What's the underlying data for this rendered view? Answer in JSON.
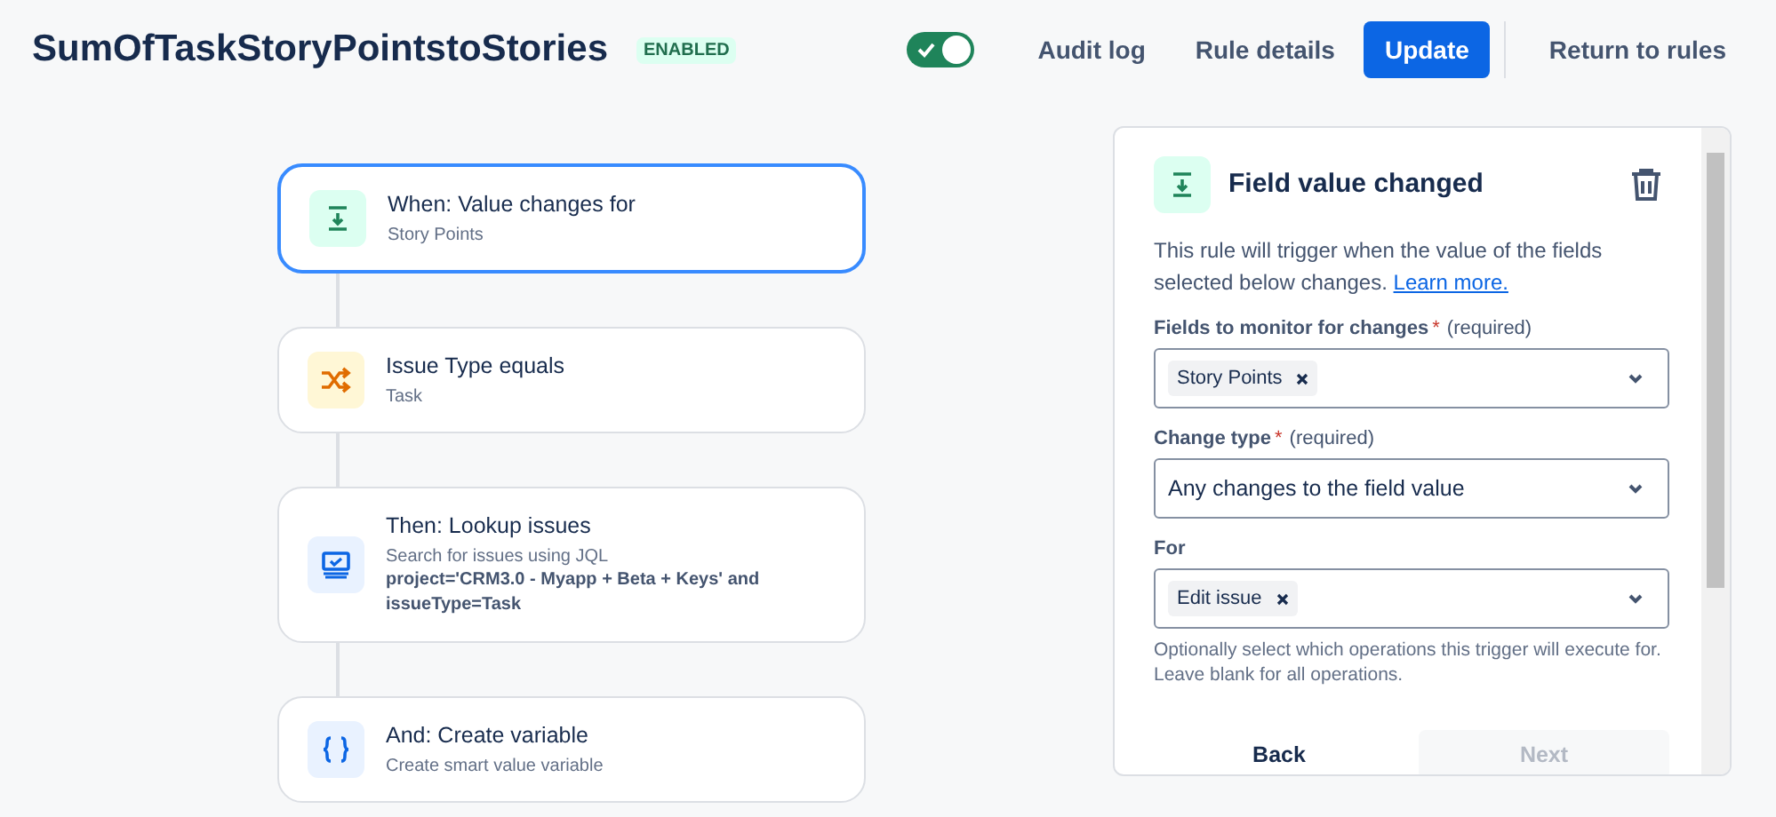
{
  "header": {
    "title": "SumOfTaskStoryPointstoStories",
    "status_badge": "ENABLED",
    "toggle_on": true,
    "actions": [
      {
        "label": "Audit log",
        "kind": "subtle"
      },
      {
        "label": "Rule details",
        "kind": "subtle"
      },
      {
        "label": "Update",
        "kind": "primary"
      },
      {
        "label": "Return to rules",
        "kind": "subtle"
      }
    ]
  },
  "flow": [
    {
      "kind": "trigger",
      "title": "When: Value changes for",
      "lines": [
        "Story Points"
      ],
      "selected": true
    },
    {
      "kind": "condition",
      "title": "Issue Type equals",
      "lines": [
        "Task"
      ],
      "selected": false
    },
    {
      "kind": "action",
      "title": "Then: Lookup issues",
      "lines": [
        "Search for issues using JQL"
      ],
      "code": "project='CRM3.0 - Myapp + Beta + Keys' and issueType=Task",
      "selected": false
    },
    {
      "kind": "variable",
      "title": "And: Create variable",
      "lines": [
        "Create smart value variable"
      ],
      "selected": false
    }
  ],
  "panel": {
    "title": "Field value changed",
    "description": "This rule will trigger when the value of the fields selected below changes.",
    "link": "Learn more.",
    "fields": [
      {
        "kind": "multi",
        "label": "Fields to monitor for changes",
        "required_mark": "*",
        "required_hint": "(required)",
        "tags": [
          "Story Points"
        ]
      },
      {
        "kind": "single",
        "label": "Change type",
        "required_mark": "*",
        "required_hint": "(required)",
        "value": "Any changes to the field value"
      },
      {
        "kind": "multi",
        "label": "For",
        "tags": [
          "Edit issue"
        ],
        "helper": "Optionally select which operations this trigger will execute for. Leave blank for all operations."
      }
    ],
    "buttons": [
      {
        "label": "Back",
        "disabled": false
      },
      {
        "label": "Next",
        "disabled": true
      }
    ]
  }
}
